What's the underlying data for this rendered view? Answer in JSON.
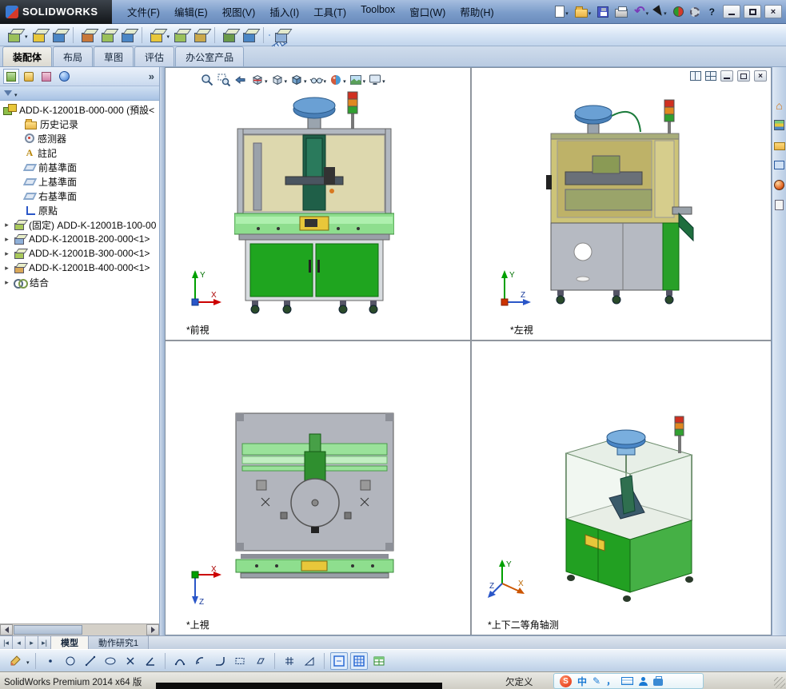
{
  "titlebar": {
    "logo_text": "SOLIDWORKS",
    "help_label": "?",
    "close_glyph": "×",
    "window_controls": [
      "help",
      "minimize",
      "maximize",
      "close"
    ]
  },
  "menu": {
    "items": [
      "文件(F)",
      "编辑(E)",
      "视图(V)",
      "插入(I)",
      "工具(T)",
      "Toolbox",
      "窗口(W)",
      "帮助(H)"
    ]
  },
  "quick_tools": {
    "icons": [
      "new-document",
      "open-document",
      "save",
      "print",
      "undo",
      "select-cursor",
      "rebuild",
      "options"
    ],
    "undo_glyph": "↶"
  },
  "assembly_toolbar": {
    "icons": [
      "insert-components",
      "mate",
      "linear-component-pattern",
      "smart-fasteners",
      "move-component",
      "show-hidden-components",
      "assembly-features",
      "reference-geometry",
      "new-motion-study",
      "bill-of-materials",
      "exploded-view",
      "instant-3d",
      "measure"
    ]
  },
  "command_tabs": {
    "items": [
      "装配体",
      "布局",
      "草图",
      "评估",
      "办公室产品"
    ],
    "active": "装配体"
  },
  "panel": {
    "tabs": [
      "feature-manager",
      "property-manager",
      "configuration-manager",
      "display-manager"
    ],
    "more_glyph": "»"
  },
  "feature_tree": {
    "expand_glyph": "▸",
    "annotation_glyph": "A",
    "root": {
      "label": "ADD-K-12001B-000-000 (預設<"
    },
    "items": [
      {
        "label": "历史记录"
      },
      {
        "label": "感测器"
      },
      {
        "label": "註記"
      },
      {
        "label": "前基準面"
      },
      {
        "label": "上基準面"
      },
      {
        "label": "右基準面"
      },
      {
        "label": "原點"
      },
      {
        "label": "(固定) ADD-K-12001B-100-00"
      },
      {
        "label": "ADD-K-12001B-200-000<1>"
      },
      {
        "label": "ADD-K-12001B-300-000<1>"
      },
      {
        "label": "ADD-K-12001B-400-000<1>"
      },
      {
        "label": "结合"
      }
    ]
  },
  "viewport": {
    "hud_icons": [
      "zoom-to-fit",
      "zoom-to-area",
      "previous-view",
      "section-view",
      "view-orientation",
      "display-style",
      "hide-show-items",
      "edit-appearance",
      "apply-scene",
      "view-settings"
    ],
    "views": [
      {
        "id": "front",
        "label": "*前視"
      },
      {
        "id": "left",
        "label": "*左視"
      },
      {
        "id": "top",
        "label": "*上視"
      },
      {
        "id": "isometric",
        "label": "*上下二等角轴测"
      }
    ]
  },
  "task_pane": {
    "icons": [
      "home",
      "design-library",
      "file-explorer",
      "view-palette",
      "appearances",
      "custom-properties"
    ],
    "home_glyph": "⌂"
  },
  "bottom_tabs": {
    "nav": {
      "first": "|◂",
      "prev": "◂",
      "next": "▸",
      "last": "▸|"
    },
    "items": [
      "模型",
      "動作研究1"
    ],
    "active": "模型"
  },
  "sketch_toolbar": {
    "icons": [
      "sketch",
      "point",
      "circle",
      "line",
      "ellipse",
      "centerline-cross",
      "angle-line",
      "three-point-arc",
      "centerpoint-arc",
      "tangent-arc",
      "corner-rectangle",
      "parallelogram",
      "linear-sketch-pattern",
      "chamfer",
      "plane",
      "grid-system",
      "tables"
    ]
  },
  "statusbar": {
    "left": "SolidWorks Premium 2014 x64 版",
    "state": "欠定义"
  },
  "ime": {
    "logo": "S",
    "lang": "中",
    "pen_glyph": "✎",
    "comma_glyph": "，"
  }
}
